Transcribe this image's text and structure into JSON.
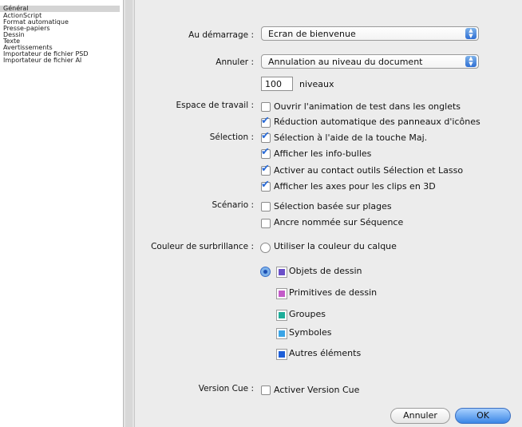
{
  "sidebar": {
    "items": [
      {
        "label": "Général",
        "selected": true
      },
      {
        "label": "ActionScript"
      },
      {
        "label": "Format automatique"
      },
      {
        "label": "Presse-papiers"
      },
      {
        "label": "Dessin"
      },
      {
        "label": "Texte"
      },
      {
        "label": "Avertissements"
      },
      {
        "label": "Importateur de fichier PSD"
      },
      {
        "label": "Importateur de fichier AI"
      }
    ]
  },
  "startup": {
    "label": "Au démarrage :",
    "value": "Ecran de bienvenue"
  },
  "undo": {
    "label": "Annuler :",
    "value": "Annulation au niveau du document",
    "levels_value": "100",
    "levels_label": "niveaux"
  },
  "workspace": {
    "label": "Espace de travail :",
    "options": [
      {
        "label": "Ouvrir l'animation de test dans les onglets",
        "checked": false
      },
      {
        "label": "Réduction automatique des panneaux d'icônes",
        "checked": true
      }
    ]
  },
  "selection": {
    "label": "Sélection :",
    "options": [
      {
        "label": "Sélection à l'aide de la touche Maj.",
        "checked": true
      },
      {
        "label": "Afficher les info-bulles",
        "checked": true
      },
      {
        "label": "Activer au contact outils Sélection et Lasso",
        "checked": true
      },
      {
        "label": "Afficher les axes pour les clips en 3D",
        "checked": true
      }
    ]
  },
  "timeline": {
    "label": "Scénario :",
    "options": [
      {
        "label": "Sélection basée sur plages",
        "checked": false
      },
      {
        "label": "Ancre nommée sur Séquence",
        "checked": false
      }
    ]
  },
  "highlight": {
    "label": "Couleur de surbrillance :",
    "layer_option": "Utiliser la couleur du calque",
    "items": [
      {
        "label": "Objets de dessin",
        "color": "#6a4fc8"
      },
      {
        "label": "Primitives de dessin",
        "color": "#c35ac8"
      },
      {
        "label": "Groupes",
        "color": "#1fae9a"
      },
      {
        "label": "Symboles",
        "color": "#3aa4e6"
      },
      {
        "label": "Autres éléments",
        "color": "#1e5fd8"
      }
    ]
  },
  "versioncue": {
    "label": "Version Cue :",
    "option": "Activer Version Cue",
    "checked": false
  },
  "buttons": {
    "cancel": "Annuler",
    "ok": "OK"
  },
  "colors": {
    "accent": "#2b6bd6"
  }
}
